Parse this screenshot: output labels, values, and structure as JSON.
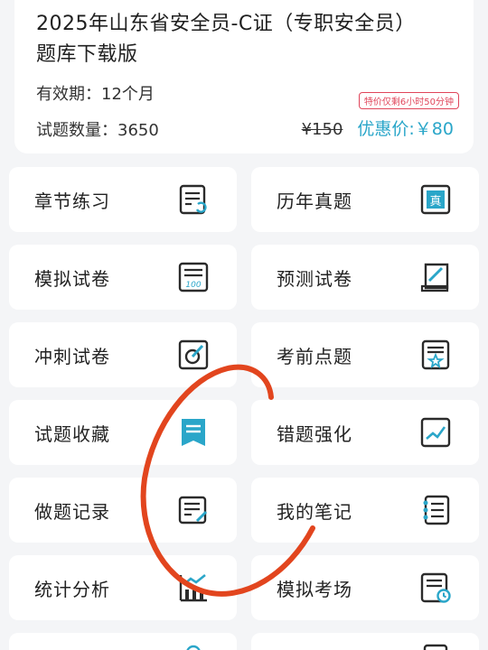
{
  "header": {
    "title_line1": "2025年山东省安全员-C证（专职安全员）",
    "title_line2": "题库下载版",
    "validity": "有效期：12个月",
    "question_count": "试题数量：3650",
    "promo_badge": "特价仅剩6小时50分钟",
    "original_price": "¥150",
    "sale_price": "优惠价:￥80"
  },
  "menu": [
    {
      "label": "章节练习",
      "icon": "chapter-practice-icon"
    },
    {
      "label": "历年真题",
      "icon": "past-exams-icon"
    },
    {
      "label": "模拟试卷",
      "icon": "mock-paper-icon"
    },
    {
      "label": "预测试卷",
      "icon": "predicted-paper-icon"
    },
    {
      "label": "冲刺试卷",
      "icon": "sprint-paper-icon"
    },
    {
      "label": "考前点题",
      "icon": "pre-exam-tips-icon"
    },
    {
      "label": "试题收藏",
      "icon": "favorites-icon"
    },
    {
      "label": "错题强化",
      "icon": "mistakes-review-icon"
    },
    {
      "label": "做题记录",
      "icon": "practice-record-icon"
    },
    {
      "label": "我的笔记",
      "icon": "notes-icon"
    },
    {
      "label": "统计分析",
      "icon": "statistics-icon"
    },
    {
      "label": "模拟考场",
      "icon": "mock-exam-room-icon"
    }
  ],
  "colors": {
    "accent": "#2aa6c9",
    "icon_stroke": "#2b2b2b",
    "promo": "#e0455a",
    "annotation": "#e2451e"
  }
}
